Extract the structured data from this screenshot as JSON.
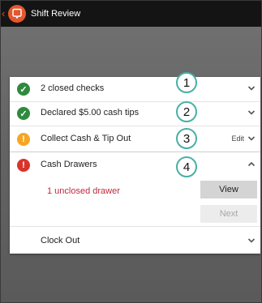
{
  "titlebar": {
    "back_glyph": "‹",
    "app_icon": "chat-bubble-icon",
    "title": "Shift Review"
  },
  "rows": [
    {
      "label": "2 closed checks",
      "status": "ok",
      "status_glyph": "✓",
      "callout": "1",
      "chevron": "down"
    },
    {
      "label": "Declared $5.00 cash tips",
      "status": "ok",
      "status_glyph": "✓",
      "callout": "2",
      "chevron": "down"
    },
    {
      "label": "Collect Cash & Tip Out",
      "status": "warn",
      "status_glyph": "!",
      "callout": "3",
      "edit_label": "Edit",
      "chevron": "down"
    },
    {
      "label": "Cash Drawers",
      "status": "error",
      "status_glyph": "!",
      "callout": "4",
      "chevron": "up"
    }
  ],
  "drawer": {
    "unclosed_text": "1 unclosed drawer",
    "view_label": "View",
    "next_label": "Next"
  },
  "clock_out": {
    "label": "Clock Out",
    "chevron": "down"
  },
  "colors": {
    "accent": "#e4572e",
    "ok": "#2f8a3e",
    "warn": "#f5a623",
    "error": "#d9342b",
    "unclosed_text": "#c0293f",
    "callout_border": "#49b0a6"
  }
}
